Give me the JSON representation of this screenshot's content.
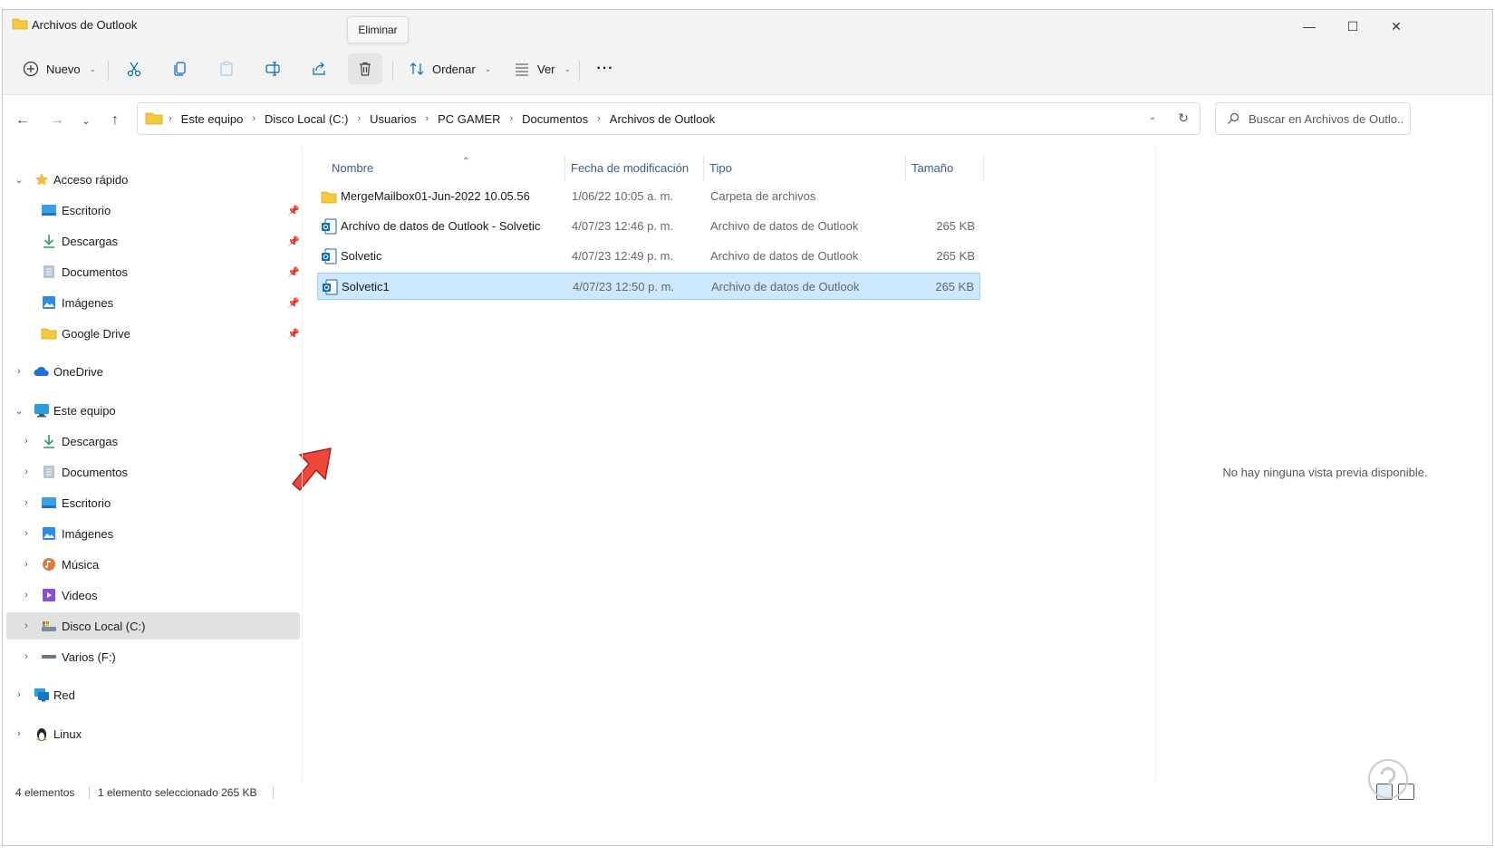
{
  "window": {
    "title": "Archivos de Outlook",
    "controls": {
      "minimize": "—",
      "maximize": "☐",
      "close": "✕"
    }
  },
  "tooltip": {
    "text": "Eliminar"
  },
  "toolbar": {
    "new_label": "Nuevo",
    "sort_label": "Ordenar",
    "view_label": "Ver",
    "more_label": "···",
    "icons": [
      "cut-icon",
      "copy-icon",
      "paste-icon",
      "rename-icon",
      "share-icon",
      "delete-icon"
    ]
  },
  "address": {
    "breadcrumbs": [
      "Este equipo",
      "Disco Local (C:)",
      "Usuarios",
      "PC GAMER",
      "Documentos",
      "Archivos de Outlook"
    ],
    "search_placeholder": "Buscar en Archivos de Outlo..."
  },
  "sidebar": {
    "quick_access": {
      "label": "Acceso rápido",
      "items": [
        {
          "label": "Escritorio",
          "icon": "desktop-icon"
        },
        {
          "label": "Descargas",
          "icon": "download-icon"
        },
        {
          "label": "Documentos",
          "icon": "documents-icon"
        },
        {
          "label": "Imágenes",
          "icon": "pictures-icon"
        },
        {
          "label": "Google Drive",
          "icon": "folder-icon"
        }
      ]
    },
    "onedrive": {
      "label": "OneDrive"
    },
    "this_pc": {
      "label": "Este equipo",
      "items": [
        {
          "label": "Descargas"
        },
        {
          "label": "Documentos"
        },
        {
          "label": "Escritorio"
        },
        {
          "label": "Imágenes"
        },
        {
          "label": "Música"
        },
        {
          "label": "Videos"
        },
        {
          "label": "Disco Local (C:)"
        },
        {
          "label": "Varios (F:)"
        }
      ]
    },
    "network": {
      "label": "Red"
    },
    "linux": {
      "label": "Linux"
    }
  },
  "columns": {
    "name": "Nombre",
    "date": "Fecha de modificación",
    "type": "Tipo",
    "size": "Tamaño"
  },
  "files": [
    {
      "name": "MergeMailbox01-Jun-2022 10.05.56",
      "date": "1/06/22 10:05 a. m.",
      "type": "Carpeta de archivos",
      "size": "",
      "icon": "folder-icon"
    },
    {
      "name": "Archivo de datos de Outlook - Solvetic",
      "date": "4/07/23 12:46 p. m.",
      "type": "Archivo de datos de Outlook",
      "size": "265 KB",
      "icon": "outlook-data-icon"
    },
    {
      "name": "Solvetic",
      "date": "4/07/23 12:49 p. m.",
      "type": "Archivo de datos de Outlook",
      "size": "265 KB",
      "icon": "outlook-data-icon"
    },
    {
      "name": "Solvetic1",
      "date": "4/07/23 12:50 p. m.",
      "type": "Archivo de datos de Outlook",
      "size": "265 KB",
      "icon": "outlook-data-icon",
      "selected": true
    }
  ],
  "preview": {
    "text": "No hay ninguna vista previa disponible."
  },
  "status": {
    "count": "4 elementos",
    "selection": "1 elemento seleccionado  265 KB"
  },
  "colors": {
    "accent": "#0067c0",
    "selection_bg": "#cce8ff",
    "selection_border": "#99d1ff",
    "arrow": "#f0463c",
    "folder": "#f8c83c"
  }
}
